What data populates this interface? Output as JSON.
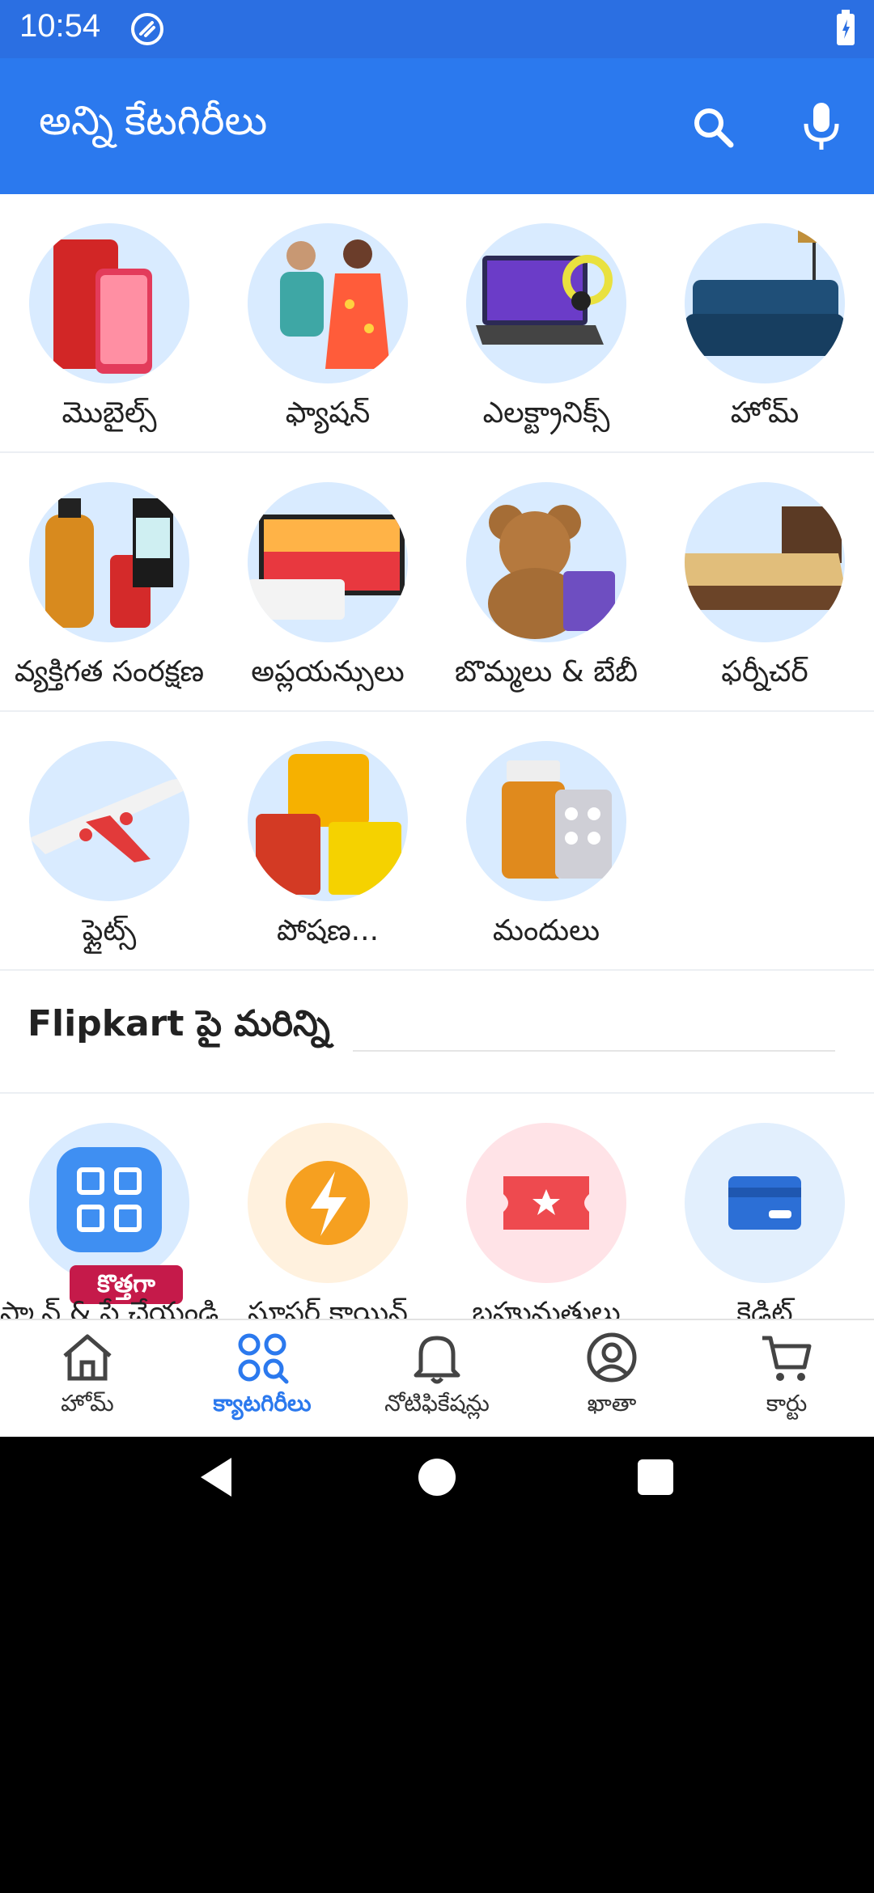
{
  "status_bar": {
    "time": "10:54"
  },
  "app_bar": {
    "title": "అన్ని కేటగిరీలు",
    "search_icon": "search-icon",
    "mic_icon": "mic-icon"
  },
  "categories": [
    {
      "label": "మొబైల్స్"
    },
    {
      "label": "ఫ్యాషన్"
    },
    {
      "label": "ఎలక్ట్రానిక్స్"
    },
    {
      "label": "హోమ్"
    },
    {
      "label": "వ్యక్తిగత సంరక్షణ"
    },
    {
      "label": "అప్లయన్సులు"
    },
    {
      "label": "బొమ్మలు & బేబీ"
    },
    {
      "label": "ఫర్నీచర్"
    },
    {
      "label": "ఫ్లైట్స్"
    },
    {
      "label": "పోషణ..."
    },
    {
      "label": "మందులు"
    }
  ],
  "more_section": {
    "title": "Flipkart పై మరిన్ని"
  },
  "tools": [
    {
      "label": "స్కాన్ & పే చేయండి",
      "badge": "కొత్తగా"
    },
    {
      "label": "సూపర్ కాయిన్"
    },
    {
      "label": "బహుమతులు"
    },
    {
      "label": "క్రెడిట్"
    }
  ],
  "bottom_nav": [
    {
      "label": "హోమ్",
      "icon": "home-icon"
    },
    {
      "label": "క్యాటగిరీలు",
      "icon": "categories-icon",
      "active": true
    },
    {
      "label": "నోటిఫికేషన్లు",
      "icon": "bell-icon"
    },
    {
      "label": "ఖాతా",
      "icon": "account-icon"
    },
    {
      "label": "కార్టు",
      "icon": "cart-icon"
    }
  ],
  "colors": {
    "primary": "#2b79ee",
    "status_bar": "#2b6fe2",
    "badge": "#c51a4a"
  }
}
